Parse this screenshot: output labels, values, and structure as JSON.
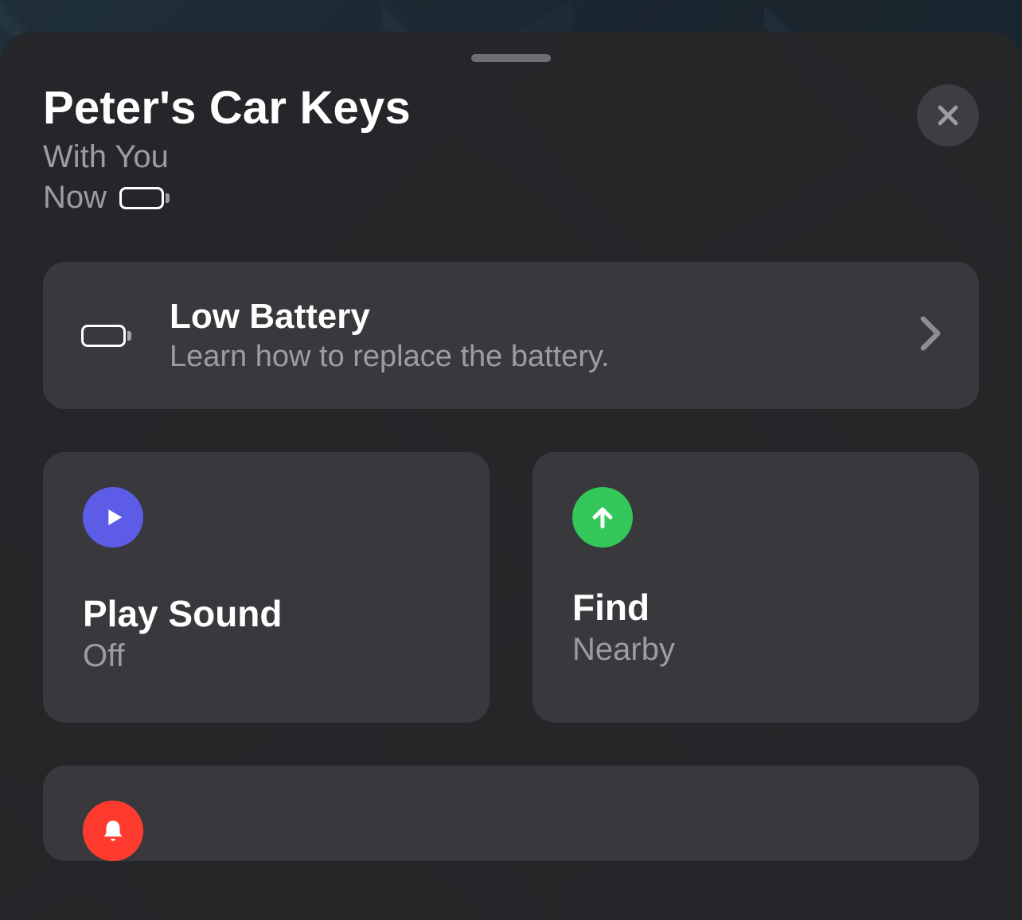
{
  "header": {
    "title": "Peter's Car Keys",
    "status": "With You",
    "time": "Now",
    "battery_level_pct": 14,
    "battery_color": "#ff4539"
  },
  "banner": {
    "title": "Low Battery",
    "subtitle": "Learn how to replace the battery."
  },
  "actions": {
    "play_sound": {
      "title": "Play Sound",
      "subtitle": "Off"
    },
    "find": {
      "title": "Find",
      "subtitle": "Nearby"
    }
  },
  "icons": {
    "close": "close-icon",
    "battery": "battery-low-icon",
    "chevron": "chevron-right-icon",
    "play": "play-icon",
    "arrow_up": "arrow-up-icon",
    "bell": "bell-icon"
  },
  "colors": {
    "purple": "#5c5ce6",
    "green": "#34c759",
    "red": "#ff3b30",
    "text_secondary": "#9c9ca2",
    "card_bg": "#39393d"
  }
}
